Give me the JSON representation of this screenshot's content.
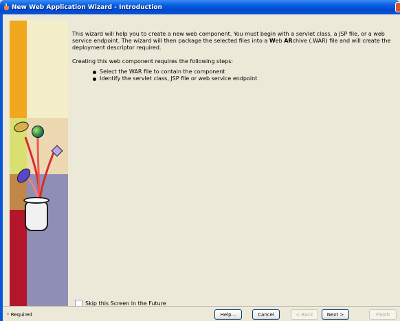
{
  "window": {
    "title": "New Web Application Wizard - Introduction"
  },
  "intro": {
    "p1_a": "This wizard will help you to create a new web component. You must begin with a servlet class, a JSP file, or a web service endpoint. The wizard will then package the selected files into a ",
    "p1_w": "W",
    "p1_b": "eb ",
    "p1_ar": "AR",
    "p1_c": "chive (.WAR) file and will create the deployment descriptor required.",
    "p2": "Creating this web component requires the following steps:",
    "steps": [
      "Select the WAR file to contain the component",
      "Identify the servlet class, JSP file or web service endpoint"
    ]
  },
  "skip": {
    "label": "Skip this Screen in the Future",
    "checked": false
  },
  "footer": {
    "required_star": "*",
    "required_label": " Required",
    "help": "Help...",
    "cancel": "Cancel",
    "back": "< Back",
    "next": "Next >",
    "finish": "Finish"
  }
}
